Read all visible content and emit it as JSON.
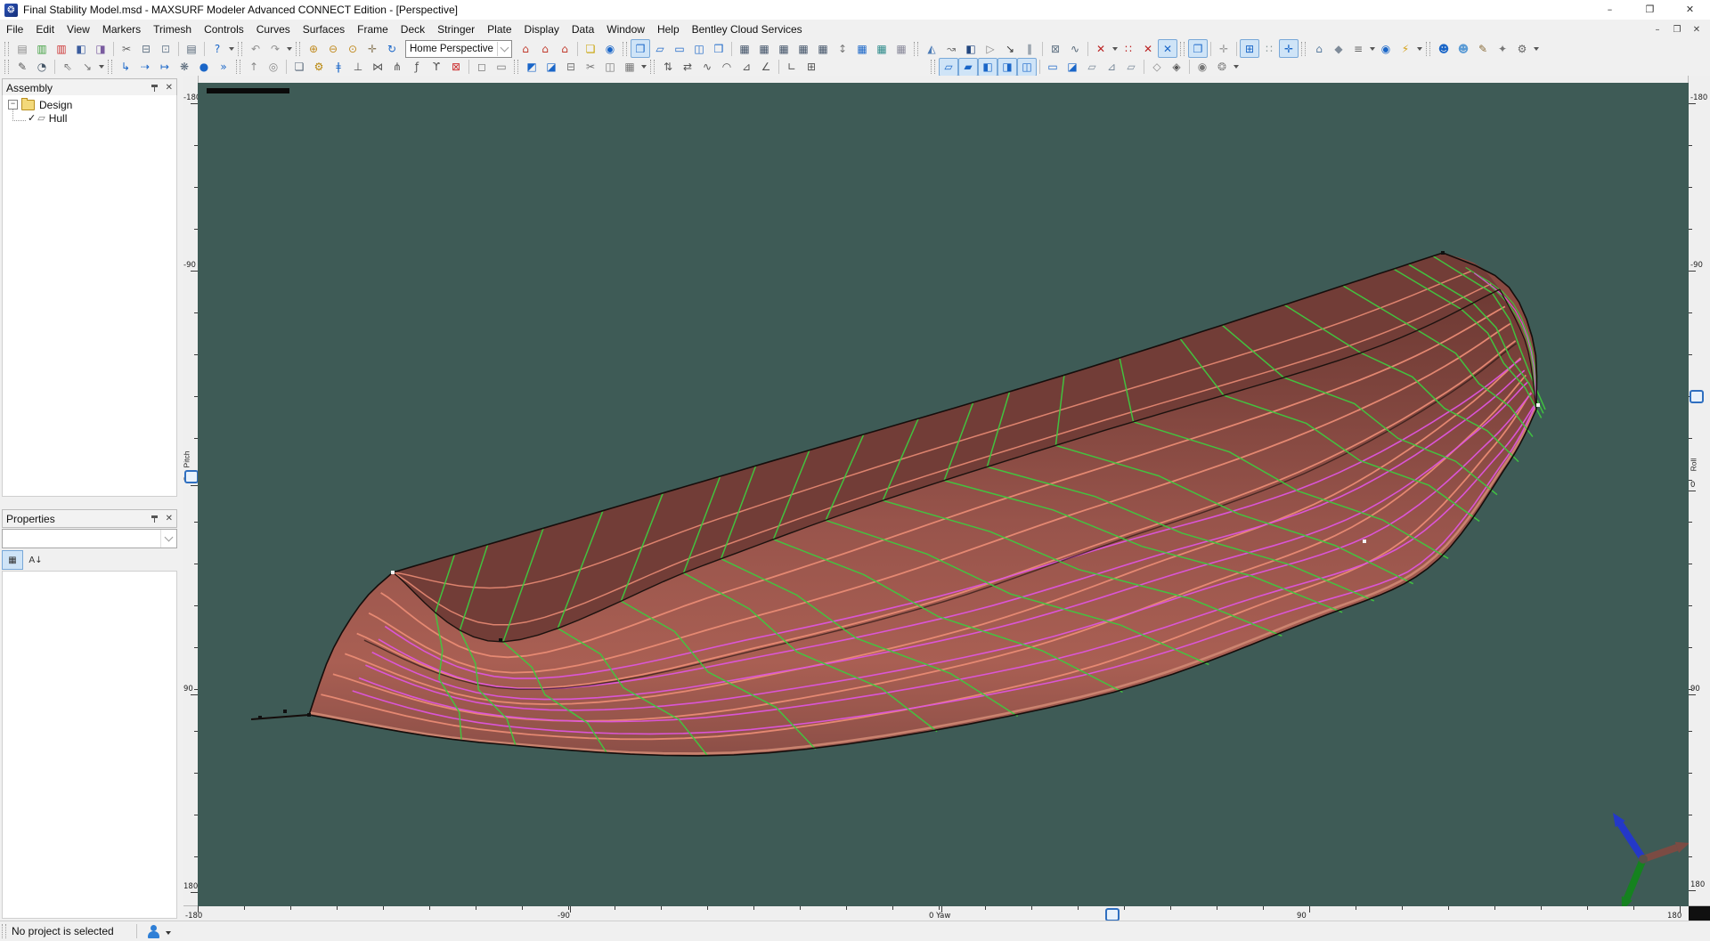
{
  "window": {
    "title": "Final Stability Model.msd - MAXSURF Modeler Advanced CONNECT Edition - [Perspective]",
    "icon_glyph": "❂",
    "controls": {
      "minimize": "–",
      "maximize": "❐",
      "close": "✕"
    }
  },
  "menu": {
    "items": [
      "File",
      "Edit",
      "View",
      "Markers",
      "Trimesh",
      "Controls",
      "Curves",
      "Surfaces",
      "Frame",
      "Deck",
      "Stringer",
      "Plate",
      "Display",
      "Data",
      "Window",
      "Help",
      "Bentley Cloud Services"
    ],
    "child_controls": [
      "–",
      "❐",
      "✕"
    ]
  },
  "toolbar1": [
    {
      "t": "g"
    },
    {
      "g": "▤",
      "c": "#8a8a8a",
      "n": "new-design"
    },
    {
      "g": "▥",
      "c": "#3f9f3f",
      "n": "open-design"
    },
    {
      "g": "▥",
      "c": "#cc3333",
      "n": "close-design"
    },
    {
      "g": "◧",
      "c": "#3a5c9e",
      "n": "save-design"
    },
    {
      "g": "◨",
      "c": "#7a5ca0",
      "n": "save-design-as"
    },
    {
      "t": "s"
    },
    {
      "g": "✂",
      "c": "#666666",
      "n": "cut"
    },
    {
      "g": "⊟",
      "c": "#667788",
      "n": "copy"
    },
    {
      "g": "⊡",
      "c": "#778899",
      "n": "paste"
    },
    {
      "t": "s"
    },
    {
      "g": "▤",
      "c": "#556677",
      "n": "print"
    },
    {
      "t": "s"
    },
    {
      "g": "?",
      "c": "#1a66c8",
      "n": "help"
    },
    {
      "t": "v"
    },
    {
      "t": "g"
    },
    {
      "g": "↶",
      "c": "#909090",
      "n": "undo"
    },
    {
      "g": "↷",
      "c": "#909090",
      "n": "redo"
    },
    {
      "t": "v"
    },
    {
      "t": "g"
    },
    {
      "g": "⊕",
      "c": "#c08a1e",
      "n": "zoom-in"
    },
    {
      "g": "⊖",
      "c": "#c08a1e",
      "n": "zoom-out"
    },
    {
      "g": "⊙",
      "c": "#c08a1e",
      "n": "zoom-window"
    },
    {
      "g": "✛",
      "c": "#8a7a5a",
      "n": "pan"
    },
    {
      "g": "↻",
      "c": "#1a66c8",
      "n": "rotate-view"
    },
    {
      "t": "c",
      "v": "Home Perspective",
      "n": "view-selector"
    },
    {
      "g": "⌂",
      "c": "#c0392b",
      "n": "home-view"
    },
    {
      "g": "⌂",
      "c": "#c0392b",
      "n": "saved-view"
    },
    {
      "g": "⌂",
      "c": "#c0392b",
      "n": "set-home-view"
    },
    {
      "t": "s"
    },
    {
      "g": "❏",
      "c": "#c8a200",
      "n": "assembly-window"
    },
    {
      "g": "◉",
      "c": "#1a66c8",
      "n": "projectwise-link"
    },
    {
      "t": "g"
    },
    {
      "g": "❐",
      "c": "#1a66c8",
      "n": "perspective-window",
      "h": 1
    },
    {
      "g": "▱",
      "c": "#1a66c8",
      "n": "plan-window"
    },
    {
      "g": "▭",
      "c": "#1a66c8",
      "n": "profile-window"
    },
    {
      "g": "◫",
      "c": "#1a66c8",
      "n": "body-plan-window"
    },
    {
      "g": "❒",
      "c": "#1a66c8",
      "n": "arrange-windows"
    },
    {
      "t": "s"
    },
    {
      "g": "▦",
      "c": "#44556a",
      "n": "markers-table"
    },
    {
      "g": "▦",
      "c": "#44556a",
      "n": "offsets-table"
    },
    {
      "g": "▦",
      "c": "#44556a",
      "n": "control-points-table"
    },
    {
      "g": "▦",
      "c": "#44556a",
      "n": "curve-table"
    },
    {
      "g": "▦",
      "c": "#44556a",
      "n": "frames-table"
    },
    {
      "g": "↕",
      "c": "#777777",
      "n": "sort-rows"
    },
    {
      "g": "▦",
      "c": "#1a66c8",
      "n": "calculations-table"
    },
    {
      "g": "▦",
      "c": "#2e8b8b",
      "n": "data-table"
    },
    {
      "g": "▦",
      "c": "#888899",
      "n": "results-table"
    },
    {
      "t": "g"
    },
    {
      "g": "◭",
      "c": "#4a7ab5",
      "n": "render"
    },
    {
      "g": "↝",
      "c": "#777777",
      "n": "flow-lines"
    },
    {
      "g": "◧",
      "c": "#23477f",
      "n": "half-model"
    },
    {
      "g": "▷",
      "c": "#888888",
      "n": "animate"
    },
    {
      "g": "↘",
      "c": "#333333",
      "n": "measure"
    },
    {
      "g": "∥",
      "c": "#556677",
      "n": "section-planes"
    },
    {
      "t": "s"
    },
    {
      "g": "⊠",
      "c": "#667788",
      "n": "background-image"
    },
    {
      "g": "∿",
      "c": "#556677",
      "n": "curvature-display"
    },
    {
      "t": "s"
    },
    {
      "g": "✕",
      "c": "#bb2222",
      "n": "delete-marker"
    },
    {
      "t": "v"
    },
    {
      "g": "∷",
      "c": "#bb2222",
      "n": "marker-options"
    },
    {
      "g": "✕",
      "c": "#bb2222",
      "n": "delete-all-markers"
    },
    {
      "g": "✕",
      "c": "#1a66c8",
      "n": "marker-snap",
      "h": 1
    },
    {
      "t": "g"
    },
    {
      "g": "❐",
      "c": "#1a66c8",
      "n": "active-view",
      "h": 1
    },
    {
      "t": "s"
    },
    {
      "g": "✛",
      "c": "#999999",
      "n": "grid-toggle"
    },
    {
      "t": "s"
    },
    {
      "g": "⊞",
      "c": "#1a66c8",
      "n": "snap-to-grid",
      "h": 1
    },
    {
      "g": "∷",
      "c": "#889999",
      "n": "point-snap"
    },
    {
      "g": "✛",
      "c": "#1a66c8",
      "n": "intersection-snap",
      "h": 1
    },
    {
      "t": "g"
    },
    {
      "g": "⌂",
      "c": "#5b7da0",
      "n": "shade-mode"
    },
    {
      "g": "◆",
      "c": "#7f8b99",
      "n": "solid-mode"
    },
    {
      "g": "≡",
      "c": "#666666",
      "n": "display-options"
    },
    {
      "t": "v"
    },
    {
      "g": "◉",
      "c": "#1a66c8",
      "n": "check-model"
    },
    {
      "g": "⚡",
      "c": "#d4a017",
      "n": "quick-update"
    },
    {
      "t": "v"
    },
    {
      "t": "g"
    },
    {
      "g": "☻",
      "c": "#1a66c8",
      "n": "accounts"
    },
    {
      "g": "☻",
      "c": "#5b9bd5",
      "n": "share"
    },
    {
      "g": "✎",
      "c": "#8a6d3b",
      "n": "markup"
    },
    {
      "g": "✦",
      "c": "#777777",
      "n": "pin-tool"
    },
    {
      "g": "⚙",
      "c": "#666666",
      "n": "options"
    },
    {
      "t": "v"
    }
  ],
  "toolbar2": [
    {
      "t": "g"
    },
    {
      "g": "✎",
      "c": "#555555",
      "n": "sketch-tool"
    },
    {
      "g": "◔",
      "c": "#445566",
      "n": "arc-tool"
    },
    {
      "t": "s"
    },
    {
      "g": "⇖",
      "c": "#777777",
      "n": "select-tool"
    },
    {
      "g": "↘",
      "c": "#777777",
      "n": "move-control-point"
    },
    {
      "t": "v"
    },
    {
      "t": "g"
    },
    {
      "g": "↳",
      "c": "#1a66c8",
      "n": "add-point"
    },
    {
      "g": "⇢",
      "c": "#1a66c8",
      "n": "append-point"
    },
    {
      "g": "↦",
      "c": "#1a66c8",
      "n": "insert-point"
    },
    {
      "g": "❋",
      "c": "#556677",
      "n": "smooth-surface"
    },
    {
      "g": "●",
      "c": "#1a66c8",
      "n": "node-edit"
    },
    {
      "g": "»",
      "c": "#1a66c8",
      "n": "next-station"
    },
    {
      "t": "g"
    },
    {
      "g": "↑",
      "c": "#888888",
      "n": "raise-row"
    },
    {
      "g": "◎",
      "c": "#888888",
      "n": "orbit-point"
    },
    {
      "t": "s"
    },
    {
      "g": "❏",
      "c": "#556677",
      "n": "add-surface"
    },
    {
      "g": "⚙",
      "c": "#b8860b",
      "n": "surface-properties"
    },
    {
      "g": "ǂ",
      "c": "#1a66c8",
      "n": "bond-edges"
    },
    {
      "g": "⊥",
      "c": "#555555",
      "n": "align-normal"
    },
    {
      "g": "⋈",
      "c": "#555555",
      "n": "join-surfaces"
    },
    {
      "g": "⋔",
      "c": "#555555",
      "n": "split-surface"
    },
    {
      "g": "ƒ",
      "c": "#555555",
      "n": "fit-surface"
    },
    {
      "g": "ϒ",
      "c": "#555555",
      "n": "fork-edge"
    },
    {
      "g": "⊠",
      "c": "#cc3333",
      "n": "trim-surface"
    },
    {
      "t": "s"
    },
    {
      "g": "◻",
      "c": "#777777",
      "n": "outline-box"
    },
    {
      "g": "▭",
      "c": "#777777",
      "n": "bounding-box"
    },
    {
      "t": "g"
    },
    {
      "g": "◩",
      "c": "#1a66c8",
      "n": "flip-normals"
    },
    {
      "g": "◪",
      "c": "#1a66c8",
      "n": "mirror-surface"
    },
    {
      "g": "⊟",
      "c": "#777777",
      "n": "collapse"
    },
    {
      "g": "✂",
      "c": "#777777",
      "n": "trim-curves"
    },
    {
      "g": "◫",
      "c": "#777777",
      "n": "untrim"
    },
    {
      "g": "▦",
      "c": "#777777",
      "n": "mesh"
    },
    {
      "t": "v"
    },
    {
      "t": "g"
    },
    {
      "g": "⇅",
      "c": "#555555",
      "n": "swap-columns"
    },
    {
      "g": "⇄",
      "c": "#555555",
      "n": "swap-rows"
    },
    {
      "g": "∿",
      "c": "#555555",
      "n": "fair-curve"
    },
    {
      "g": "◠",
      "c": "#555555",
      "n": "fillet"
    },
    {
      "g": "⊿",
      "c": "#555555",
      "n": "triangle-mesh"
    },
    {
      "g": "∠",
      "c": "#555555",
      "n": "angle-tool"
    },
    {
      "t": "s"
    },
    {
      "g": "∟",
      "c": "#555555",
      "n": "perpendicular"
    },
    {
      "g": "⊞",
      "c": "#555555",
      "n": "array-copy"
    },
    {
      "t": "p",
      "w": 120
    },
    {
      "t": "g"
    },
    {
      "g": "▱",
      "c": "#1a66c8",
      "n": "show-control-net",
      "h": 1
    },
    {
      "g": "▰",
      "c": "#1a66c8",
      "n": "show-surfaces",
      "h": 1
    },
    {
      "g": "◧",
      "c": "#1a66c8",
      "n": "show-sections",
      "h": 1
    },
    {
      "g": "◨",
      "c": "#1a66c8",
      "n": "show-waterlines",
      "h": 1
    },
    {
      "g": "◫",
      "c": "#1a66c8",
      "n": "show-buttocks",
      "h": 1
    },
    {
      "t": "s"
    },
    {
      "g": "▭",
      "c": "#1a66c8",
      "n": "show-markers"
    },
    {
      "g": "◪",
      "c": "#1a66c8",
      "n": "show-trimmed"
    },
    {
      "g": "▱",
      "c": "#7a8a9a",
      "n": "show-grid"
    },
    {
      "g": "⊿",
      "c": "#7a8a9a",
      "n": "show-diagonals"
    },
    {
      "g": "▱",
      "c": "#7a8a9a",
      "n": "show-edges"
    },
    {
      "t": "s"
    },
    {
      "g": "◇",
      "c": "#888888",
      "n": "wireframe-mode"
    },
    {
      "g": "◈",
      "c": "#555555",
      "n": "shaded-mode"
    },
    {
      "t": "s"
    },
    {
      "g": "◉",
      "c": "#777777",
      "n": "trackball"
    },
    {
      "g": "❂",
      "c": "#888888",
      "n": "spin-control"
    },
    {
      "t": "v"
    }
  ],
  "assembly": {
    "title": "Assembly",
    "root_label": "Design",
    "child_label": "Hull"
  },
  "properties": {
    "title": "Properties",
    "combo_value": "",
    "buttons": [
      {
        "n": "categorized-view",
        "g": "▦"
      },
      {
        "n": "sort-az",
        "g": "A↓"
      }
    ]
  },
  "icons": {
    "expander": "−",
    "close": "✕",
    "check": "✓",
    "surface": "▱",
    "help": "?"
  },
  "viewport": {
    "bg": "#3e5b56",
    "rulers": {
      "left": {
        "axis": "Pitch",
        "majors": [
          [
            "-180",
            116
          ],
          [
            "-90",
            304
          ],
          [
            "0",
            545
          ],
          [
            "90",
            780
          ],
          [
            "180",
            1002
          ]
        ],
        "minor_step": 47,
        "marker": 528
      },
      "right": {
        "axis": "Roll",
        "majors": [
          [
            "-180",
            116
          ],
          [
            "-90",
            304
          ],
          [
            "0",
            551
          ],
          [
            "90",
            780
          ],
          [
            "180",
            1000
          ]
        ],
        "minor_step": 47,
        "marker": 438
      },
      "bottom": {
        "axis": "Yaw",
        "majors": [
          [
            "-180",
            222
          ],
          [
            "-90",
            640
          ],
          [
            "0 Yaw",
            1057
          ],
          [
            "90",
            1470
          ],
          [
            "180",
            1886
          ]
        ],
        "minor_step": 52,
        "marker": 1241
      }
    },
    "triad": {
      "x_color": "#7b4b43",
      "y_color": "#15821f",
      "z_color": "#2438c8"
    }
  },
  "hull": {
    "sections": 19,
    "waterlines": 6,
    "diagonals": 6,
    "deck_lines": 2,
    "colors": {
      "side_top": "#6e3a34",
      "side_mid": "#98544b",
      "side_bottom": "#a95f53",
      "deck": "#723d37",
      "transom": "#8a4a42",
      "outline": "#150d0b",
      "waterline": "#e98b74",
      "section": "#3fc83f",
      "diagonal": "#dd55dd",
      "highlight": "#d28b76",
      "cp_dark": "#101010",
      "cp_light": "#f2f2f2"
    }
  },
  "statusbar": {
    "message": "No project is selected"
  }
}
